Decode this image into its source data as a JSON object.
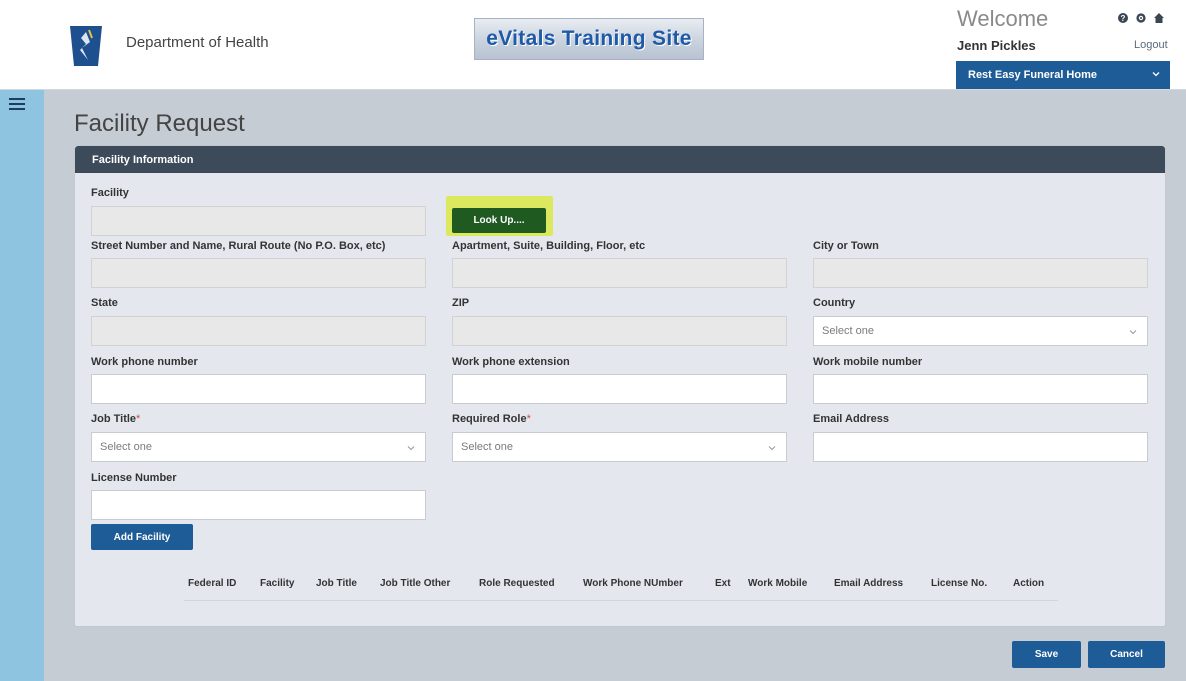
{
  "header": {
    "department": "Department of Health",
    "site_banner": "eVitals Training Site",
    "welcome": "Welcome",
    "user_name": "Jenn Pickles",
    "logout": "Logout",
    "organization": "Rest Easy Funeral Home",
    "icons": [
      "help-icon",
      "gear-icon",
      "home-icon"
    ]
  },
  "page": {
    "title": "Facility Request"
  },
  "panel": {
    "heading": "Facility Information",
    "fields": {
      "facility": {
        "label": "Facility",
        "value": ""
      },
      "street": {
        "label": "Street Number and Name, Rural Route (No P.O. Box, etc)",
        "value": ""
      },
      "apartment": {
        "label": "Apartment, Suite, Building, Floor, etc",
        "value": ""
      },
      "city": {
        "label": "City or Town",
        "value": ""
      },
      "state": {
        "label": "State",
        "value": ""
      },
      "zip": {
        "label": "ZIP",
        "value": ""
      },
      "country": {
        "label": "Country",
        "placeholder": "Select one"
      },
      "work_phone": {
        "label": "Work phone number",
        "value": ""
      },
      "work_ext": {
        "label": "Work phone extension",
        "value": ""
      },
      "work_mobile": {
        "label": "Work mobile number",
        "value": ""
      },
      "job_title": {
        "label": "Job Title",
        "required": "*",
        "placeholder": "Select one"
      },
      "required_role": {
        "label": "Required Role",
        "required": "*",
        "placeholder": "Select one"
      },
      "email": {
        "label": "Email Address",
        "value": ""
      },
      "license": {
        "label": "License Number",
        "value": ""
      }
    },
    "lookup_button": "Look Up....",
    "add_button": "Add Facility",
    "table_columns": [
      "Federal ID",
      "Facility",
      "Job Title",
      "Job Title Other",
      "Role Requested",
      "Work Phone NUmber",
      "Ext",
      "Work Mobile",
      "Email Address",
      "License No.",
      "Action"
    ]
  },
  "footer": {
    "save": "Save",
    "cancel": "Cancel"
  },
  "colors": {
    "primary_button": "#1e5c98",
    "panel_header": "#3c4a5a",
    "lookup_button": "#1f5b20",
    "lookup_highlight": "#dce95f",
    "sidebar": "#8fc4e1"
  }
}
